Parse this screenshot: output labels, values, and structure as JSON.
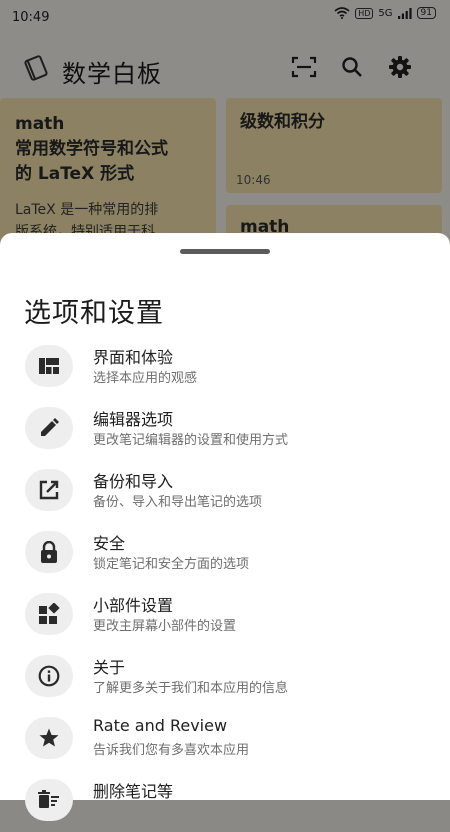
{
  "status_bar": {
    "time": "10:49",
    "hd": "HD",
    "network": "5G",
    "battery": "91"
  },
  "app_bar": {
    "title": "数学白板",
    "icons": [
      "notebook-icon",
      "scan-icon",
      "search-icon",
      "gear-icon"
    ]
  },
  "notes": [
    {
      "title_line1": "math",
      "title_line2": "常用数学符号和公式",
      "title_line3": "的 LaTeX 形式",
      "body_line1": "LaTeX 是一种常用的排",
      "body_line2": "版系统，特别适用于科"
    },
    {
      "title": "级数和积分",
      "time": "10:46"
    },
    {
      "title": "math"
    }
  ],
  "sheet": {
    "title": "选项和设置",
    "options": [
      {
        "label": "界面和体验",
        "desc": "选择本应用的观感",
        "icon": "dashboard-icon"
      },
      {
        "label": "编辑器选项",
        "desc": "更改笔记编辑器的设置和使用方式",
        "icon": "pencil-icon"
      },
      {
        "label": "备份和导入",
        "desc": "备份、导入和导出笔记的选项",
        "icon": "export-icon"
      },
      {
        "label": "安全",
        "desc": "锁定笔记和安全方面的选项",
        "icon": "lock-icon"
      },
      {
        "label": "小部件设置",
        "desc": "更改主屏幕小部件的设置",
        "icon": "widgets-icon"
      },
      {
        "label": "关于",
        "desc": "了解更多关于我们和本应用的信息",
        "icon": "info-icon"
      },
      {
        "label": "Rate and Review",
        "desc": "告诉我们您有多喜欢本应用",
        "icon": "star-icon"
      },
      {
        "label": "删除笔记等",
        "desc": "",
        "icon": "delete-sweep-icon"
      }
    ]
  },
  "colors": {
    "note_card": "#f2dfa9",
    "sheet_bg": "#ffffff",
    "icon_bg": "#eeeeee",
    "icon_fg": "#2b2b2b"
  }
}
